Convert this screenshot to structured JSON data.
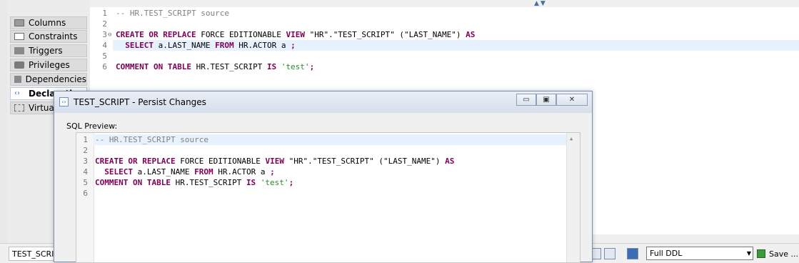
{
  "top": {
    "collapse_arrows": "▲▼"
  },
  "side_tabs": [
    {
      "label": "Columns",
      "icon": "table-columns-icon"
    },
    {
      "label": "Constraints",
      "icon": "constraints-icon"
    },
    {
      "label": "Triggers",
      "icon": "triggers-icon"
    },
    {
      "label": "Privileges",
      "icon": "key-icon"
    },
    {
      "label": "Dependencies",
      "icon": "dependencies-icon"
    },
    {
      "label": "Declarati",
      "icon": "declaration-icon"
    },
    {
      "label": "Virtual",
      "icon": "virtual-icon"
    }
  ],
  "editor": {
    "line_numbers": [
      "1",
      "2",
      "3",
      "4",
      "5",
      "6"
    ],
    "lines": [
      {
        "comment": "-- HR.TEST_SCRIPT source"
      },
      {},
      {
        "create": "CREATE",
        "or": "OR",
        "replace": "REPLACE",
        "force": "FORCE EDITIONABLE",
        "view": "VIEW",
        "name": "\"HR\".\"TEST_SCRIPT\"",
        "cols": "(\"LAST_NAME\")",
        "as": "AS"
      },
      {
        "select": "SELECT",
        "expr": "a.LAST_NAME",
        "from": "FROM",
        "table": "HR.ACTOR a",
        "semi": ";"
      },
      {},
      {
        "comment_kw": "COMMENT ON TABLE",
        "target": "HR.TEST_SCRIPT",
        "is": "IS",
        "value": "'test'",
        "semi": ";"
      }
    ]
  },
  "bottom_bar": {
    "tab_label": "TEST_SCRIPT",
    "ddl_option": "Full DDL",
    "save_label": "Save ..."
  },
  "dialog": {
    "title": "TEST_SCRIPT - Persist Changes",
    "minimize": "▭",
    "maximize": "▣",
    "close": "✕",
    "sql_label": "SQL Preview:",
    "line_numbers": [
      "1",
      "2",
      "3",
      "4",
      "5",
      "6"
    ],
    "lines": [
      {
        "comment": "-- HR.TEST_SCRIPT source"
      },
      {},
      {
        "create": "CREATE",
        "or": "OR",
        "replace": "REPLACE",
        "force": "FORCE EDITIONABLE",
        "view": "VIEW",
        "name": "\"HR\".\"TEST_SCRIPT\"",
        "cols": "(\"LAST_NAME\")",
        "as": "AS"
      },
      {
        "select": "SELECT",
        "expr": "a.LAST_NAME",
        "from": "FROM",
        "table": "HR.ACTOR a",
        "semi": ";"
      },
      {
        "comment_kw": "COMMENT ON TABLE",
        "target": "HR.TEST_SCRIPT",
        "is": "IS",
        "value": "'test'",
        "semi": ";"
      },
      {}
    ]
  },
  "colors": {
    "keyword": "#7f0055",
    "comment": "#808080",
    "string": "#2a8a2a",
    "highlight": "#e8f2fe"
  }
}
